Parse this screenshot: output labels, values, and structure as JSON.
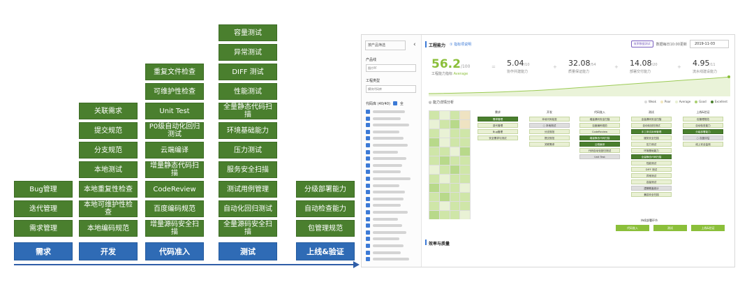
{
  "diagram": {
    "columns": [
      {
        "key": "req",
        "category": "需求",
        "items": [
          "需求管理",
          "迭代管理",
          "Bug管理"
        ]
      },
      {
        "key": "dev",
        "category": "开发",
        "items": [
          "本地编码规范",
          "本地可维护性检查",
          "本地重复性检查",
          "本地测试",
          "分支规范",
          "提交规范",
          "关联需求"
        ]
      },
      {
        "key": "ci",
        "category": "代码准入",
        "items": [
          "增量源码安全扫描",
          "百度编码规范",
          "CodeReview",
          "增量静态代码扫描",
          "云端编译",
          "P0级自动化回归测试",
          "Unit Test",
          "可维护性检查",
          "重复文件检查"
        ]
      },
      {
        "key": "test",
        "category": "测试",
        "items": [
          "全量源码安全扫描",
          "自动化回归测试",
          "测试用例管理",
          "服务安全扫描",
          "压力测试",
          "环境基础能力",
          "全量静态代码扫描",
          "性能测试",
          "DIFF 测试",
          "异常测试",
          "容量测试"
        ]
      },
      {
        "key": "rel",
        "category": "上线&验证",
        "items": [
          "包管理规范",
          "自动检查能力",
          "分级部署能力"
        ]
      }
    ]
  },
  "dashboard": {
    "filter_select": "按产品筛选",
    "collapse_icon": "chevron-left-icon",
    "product_line_label": "产品线",
    "product_line_value": "图片PF",
    "project_type_label": "工程类型",
    "project_type_value": "模块代码库",
    "repo_list_label": "代码库 (40/40)",
    "repo_select_all": "全",
    "title": "工程能力",
    "title_link": "① 指标项说明",
    "top_pill": "效率数据测试",
    "top_update": "数据每日10:00更新",
    "top_date": "2019-11-03",
    "overall": {
      "value": "56.2",
      "max": "/100",
      "label": "工程能力指标",
      "level": "Average"
    },
    "metrics": [
      {
        "value": "5.04",
        "max": "/10",
        "label": "协作共建能力"
      },
      {
        "value": "32.08",
        "max": "/54",
        "label": "质量保证能力"
      },
      {
        "value": "14.08",
        "max": "/20",
        "label": "部署交付能力"
      },
      {
        "value": "4.95",
        "max": "/11",
        "label": "流水线建设能力"
      }
    ],
    "legend": [
      {
        "label": "Weak",
        "color": "#d9d9d9"
      },
      {
        "label": "Poor",
        "color": "#f1e6bf"
      },
      {
        "label": "Average",
        "color": "#e9f0d4"
      },
      {
        "label": "Good",
        "color": "#a9cf6f"
      },
      {
        "label": "Excellent",
        "color": "#4a7f2e"
      }
    ],
    "panel_title": "◎ 能力详情分析",
    "stages": [
      {
        "title": "需求",
        "cells": [
          {
            "t": "需求管理",
            "s": "g"
          },
          {
            "t": "迭代管理",
            "s": ""
          },
          {
            "t": "Bug管理",
            "s": ""
          },
          {
            "t": "安全需求与测试",
            "s": ""
          }
        ]
      },
      {
        "title": "开发",
        "cells": [
          {
            "t": "本地代码检查",
            "s": ""
          },
          {
            "t": "○ 本地测试",
            "s": "gr"
          },
          {
            "t": "分支规范",
            "s": ""
          },
          {
            "t": "提交规范",
            "s": ""
          },
          {
            "t": "关联需求",
            "s": ""
          }
        ]
      },
      {
        "title": "代码准入",
        "cells": [
          {
            "t": "增量源码安全扫描",
            "s": ""
          },
          {
            "t": "百度编码规范",
            "s": ""
          },
          {
            "t": "CodeReview",
            "s": ""
          },
          {
            "t": "增量静态代码扫描",
            "s": "g"
          },
          {
            "t": "云端编译",
            "s": "g"
          },
          {
            "t": "代码自动化回归测试",
            "s": ""
          },
          {
            "t": "Unit Test",
            "s": "gr"
          }
        ]
      },
      {
        "title": "测试",
        "cells": [
          {
            "t": "全量源码安全扫描",
            "s": ""
          },
          {
            "t": "自动化回归测试",
            "s": ""
          },
          {
            "t": "手工测试用例管理",
            "s": "g"
          },
          {
            "t": "服务安全扫描",
            "s": ""
          },
          {
            "t": "压力测试",
            "s": ""
          },
          {
            "t": "环境基础能力",
            "s": ""
          },
          {
            "t": "全量静态代码扫描",
            "s": "g"
          },
          {
            "t": "性能测试",
            "s": ""
          },
          {
            "t": "DIFF 测试",
            "s": ""
          },
          {
            "t": "异常测试",
            "s": ""
          },
          {
            "t": "容量测试",
            "s": ""
          },
          {
            "t": "逻辑覆盖统计",
            "s": "gr"
          },
          {
            "t": "兼容安全扫描",
            "s": ""
          }
        ]
      },
      {
        "title": "上线&验证",
        "cells": [
          {
            "t": "包管理规范",
            "s": ""
          },
          {
            "t": "自动检查能力",
            "s": ""
          },
          {
            "t": "分级部署能力",
            "s": "g"
          },
          {
            "t": "○ 灰度评估",
            "s": "gr"
          },
          {
            "t": "线上安全监测",
            "s": ""
          }
        ]
      }
    ],
    "bottom_label": "持续部署环节",
    "bottom_buttons": [
      "代码准入",
      "测试",
      "上线&验证"
    ],
    "section_title": "效率与质量"
  }
}
